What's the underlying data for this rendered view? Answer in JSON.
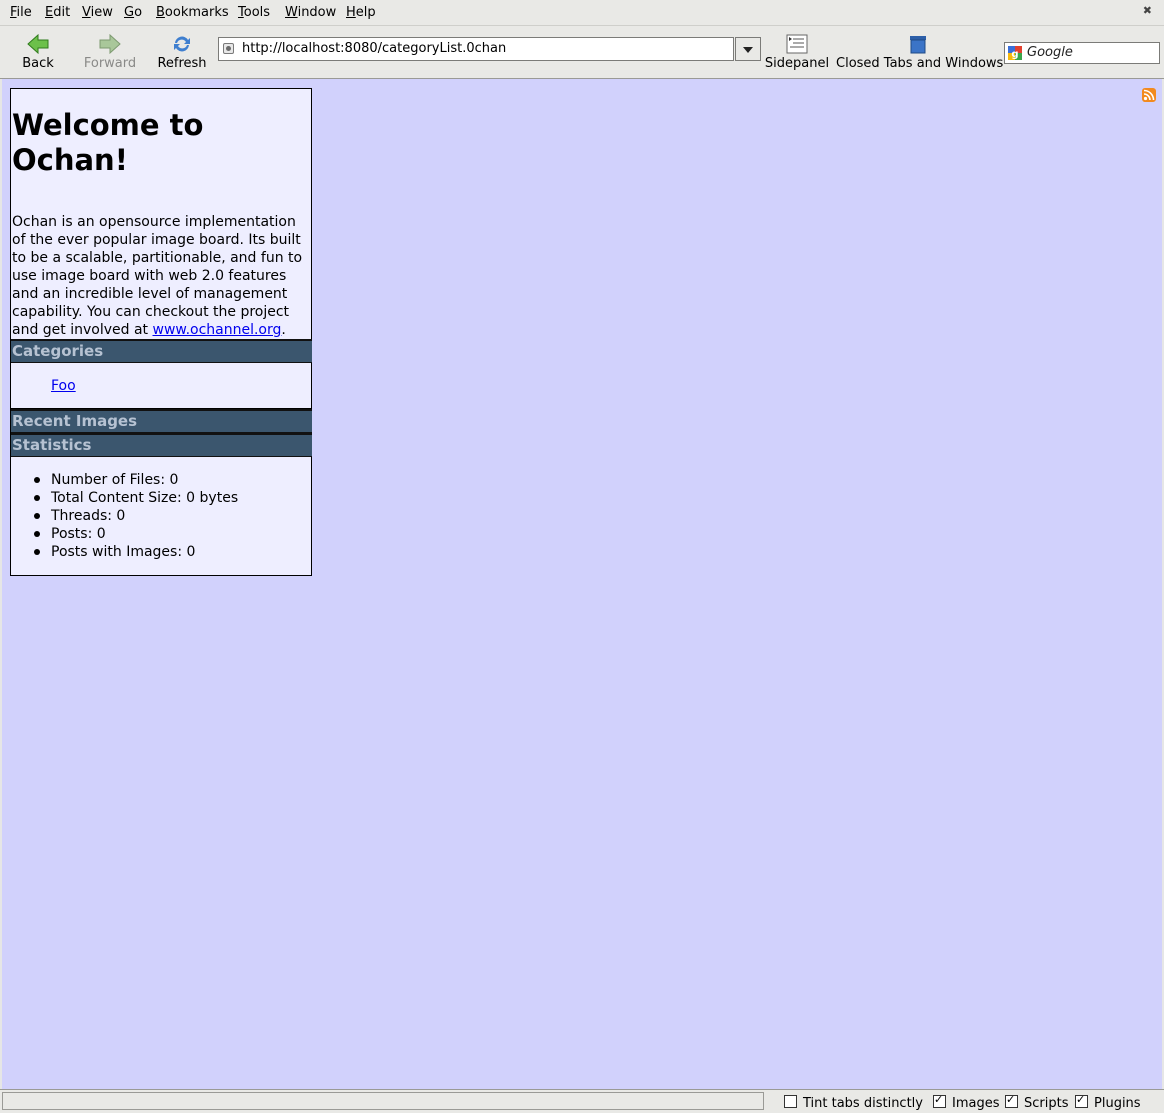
{
  "menubar": {
    "items": [
      "File",
      "Edit",
      "View",
      "Go",
      "Bookmarks",
      "Tools",
      "Window",
      "Help"
    ],
    "accels": [
      "F",
      "E",
      "V",
      "G",
      "B",
      "T",
      "W",
      "H"
    ]
  },
  "toolbar": {
    "back_label": "Back",
    "forward_label": "Forward",
    "refresh_label": "Refresh",
    "url": "http://localhost:8080/categoryList.0chan",
    "sidepanel_label": "Sidepanel",
    "closed_tabs_label": "Closed Tabs and Windows",
    "search_placeholder": "Google"
  },
  "page": {
    "title": "Welcome to Ochan!",
    "intro_text": "Ochan is an opensource implementation of the ever popular image board. Its built to be a scalable, partitionable, and fun to use image board with web 2.0 features and an incredible level of management capability. You can checkout the project and get involved at ",
    "intro_link": "www.ochannel.org",
    "intro_end": ".",
    "categories_heading": "Categories",
    "category_link": "Foo",
    "recent_images_heading": "Recent Images",
    "statistics_heading": "Statistics",
    "stats": [
      "Number of Files: 0",
      "Total Content Size: 0 bytes",
      "Threads: 0",
      "Posts: 0",
      "Posts with Images: 0"
    ]
  },
  "statusbar": {
    "tint_tabs_label": "Tint tabs distinctly",
    "tint_tabs_checked": false,
    "images_label": "Images",
    "images_checked": true,
    "scripts_label": "Scripts",
    "scripts_checked": true,
    "plugins_label": "Plugins",
    "plugins_checked": true
  },
  "colors": {
    "page_background": "#d1d1fc",
    "panel_background": "#eeeeff",
    "section_header": "#3b566e",
    "link": "#0000ee"
  }
}
